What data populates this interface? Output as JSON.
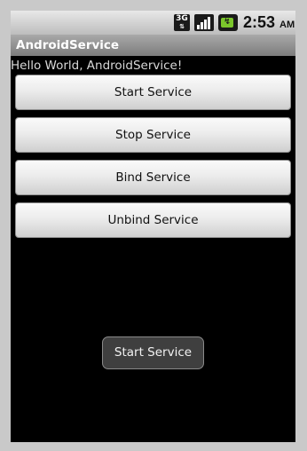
{
  "status_bar": {
    "network_label": "3G",
    "time": "2:53",
    "ampm": "AM",
    "icons": [
      "3g-network-icon",
      "signal-strength-icon",
      "battery-charging-icon"
    ]
  },
  "app": {
    "title": "AndroidService",
    "hello_text": "Hello World, AndroidService!"
  },
  "buttons": {
    "start": "Start Service",
    "stop": "Stop Service",
    "bind": "Bind Service",
    "unbind": "Unbind Service"
  },
  "toast": {
    "message": "Start Service"
  },
  "colors": {
    "battery": "#7bc62b",
    "title_bar": "#8f8f8f",
    "background": "#000000"
  }
}
